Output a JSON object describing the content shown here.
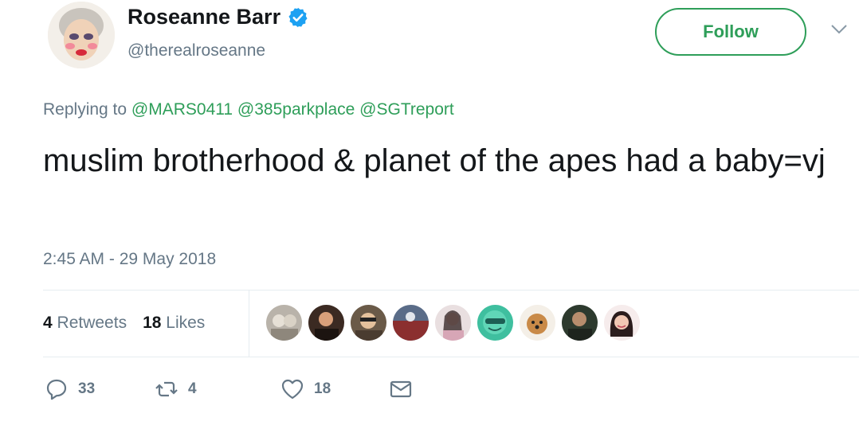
{
  "user": {
    "display_name": "Roseanne Barr",
    "handle": "@therealroseanne",
    "verified_icon": "verified-badge-icon"
  },
  "follow_label": "Follow",
  "reply": {
    "prefix": "Replying to",
    "mentions": [
      "@MARS0411",
      "@385parkplace",
      "@SGTreport"
    ]
  },
  "tweet_text": "muslim brotherhood & planet of the apes had a baby=vj",
  "timestamp": "2:45 AM - 29 May 2018",
  "stats": {
    "retweets_count": "4",
    "retweets_label": "Retweets",
    "likes_count": "18",
    "likes_label": "Likes"
  },
  "likers_count": 9,
  "actions": {
    "reply_count": "33",
    "retweet_count": "4",
    "like_count": "18"
  },
  "colors": {
    "accent": "#2e9e59",
    "verified": "#1da1f2",
    "muted": "#657786"
  }
}
